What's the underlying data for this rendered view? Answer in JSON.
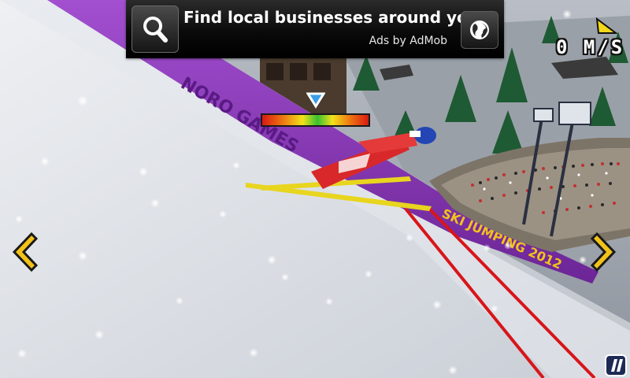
{
  "ad": {
    "headline": "Find local businesses around you!",
    "attribution": "Ads by AdMob",
    "search_icon": "search-icon",
    "globe_icon": "globe-icon"
  },
  "hud": {
    "speed": "0 M/S",
    "balance_level": 0.5
  },
  "banners": {
    "sponsor_text": "NORO GAMES",
    "game_text": "SKI JUMPING 2012"
  },
  "colors": {
    "sky_purple": "#8a3ab0",
    "arrow_yellow": "#f2c21a",
    "track_red": "#d8151a",
    "ad_background": "#000000"
  },
  "controls": {
    "left_arrow_icon": "chevron-left-icon",
    "right_arrow_icon": "chevron-right-icon",
    "pause_icon": "pause-icon"
  }
}
